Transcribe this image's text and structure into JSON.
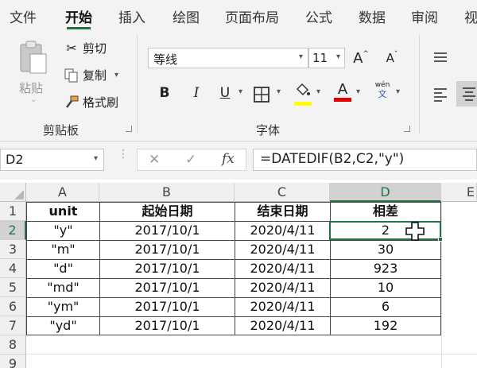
{
  "menu": {
    "tabs": [
      {
        "label": "文件"
      },
      {
        "label": "开始"
      },
      {
        "label": "插入"
      },
      {
        "label": "绘图"
      },
      {
        "label": "页面布局"
      },
      {
        "label": "公式"
      },
      {
        "label": "数据"
      },
      {
        "label": "审阅"
      },
      {
        "label": "视"
      }
    ],
    "active_tab": "开始"
  },
  "ribbon": {
    "clipboard": {
      "paste_label": "粘贴",
      "cut_label": "剪切",
      "copy_label": "复制",
      "format_painter_label": "格式刷",
      "group_label": "剪贴板"
    },
    "font": {
      "font_name": "等线",
      "font_size": "11",
      "increase_size": "A",
      "decrease_size": "A",
      "bold": "B",
      "italic": "I",
      "underline": "U",
      "font_color_letter": "A",
      "phonetic_top": "wén",
      "phonetic_bottom": "文",
      "group_label": "字体",
      "highlight_color": "#ffff00",
      "font_color": "#e00000"
    }
  },
  "formula_bar": {
    "name_box": "D2",
    "cancel_icon": "✕",
    "enter_icon": "✓",
    "fx_label": "fx",
    "formula": "=DATEDIF(B2,C2,\"y\")"
  },
  "sheet": {
    "columns": [
      "A",
      "B",
      "C",
      "D",
      "E"
    ],
    "selected_column": "D",
    "rows": [
      "1",
      "2",
      "3",
      "4",
      "5",
      "6",
      "7",
      "8",
      "9"
    ],
    "selected_row": "2",
    "headers": [
      "unit",
      "起始日期",
      "结束日期",
      "相差"
    ],
    "data": [
      [
        "\"y\"",
        "2017/10/1",
        "2020/4/11",
        "2"
      ],
      [
        "\"m\"",
        "2017/10/1",
        "2020/4/11",
        "30"
      ],
      [
        "\"d\"",
        "2017/10/1",
        "2020/4/11",
        "923"
      ],
      [
        "\"md\"",
        "2017/10/1",
        "2020/4/11",
        "10"
      ],
      [
        "\"ym\"",
        "2017/10/1",
        "2020/4/11",
        "6"
      ],
      [
        "\"yd\"",
        "2017/10/1",
        "2020/4/11",
        "192"
      ]
    ],
    "active_cell": "D2",
    "accent_color": "#217346"
  }
}
